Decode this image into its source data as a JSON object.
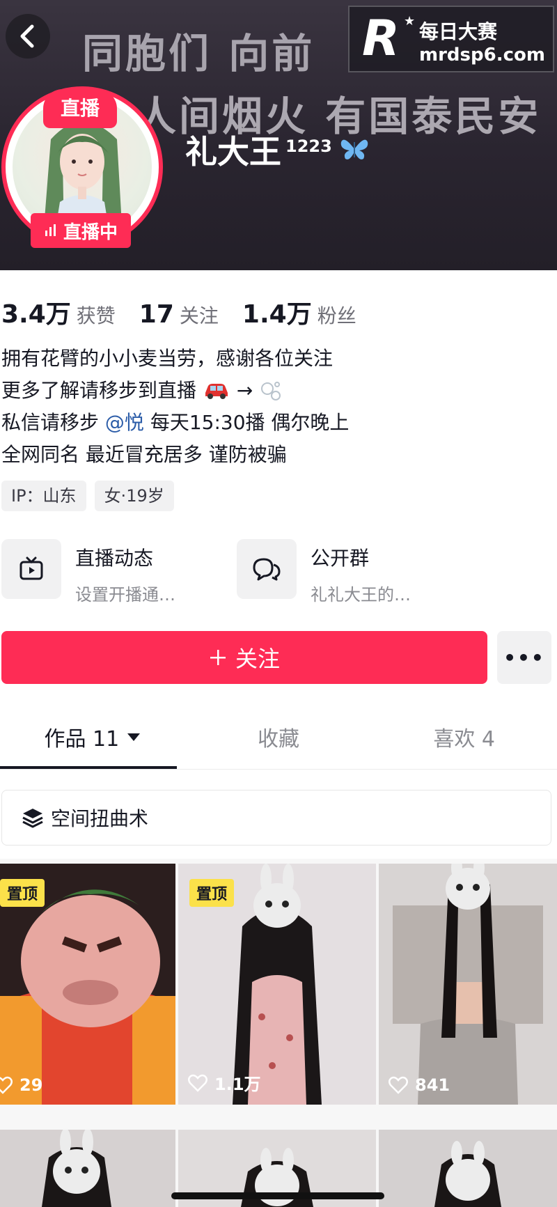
{
  "banner": {
    "line1": "同胞们 向前",
    "line2": "人间烟火 有国泰民安"
  },
  "watermark": {
    "logo": "R",
    "name": "每日大赛",
    "url": "mrdsp6.com"
  },
  "avatar": {
    "live_top": "直播",
    "live_bottom": "直播中"
  },
  "user": {
    "name": "礼大王",
    "suffix": "1223"
  },
  "stats": [
    {
      "value": "3.4万",
      "label": "获赞"
    },
    {
      "value": "17",
      "label": "关注"
    },
    {
      "value": "1.4万",
      "label": "粉丝"
    }
  ],
  "bio": {
    "line1": "拥有花臂的小小麦当劳，感谢各位关注",
    "line2": "更多了解请移步到直播",
    "line3_prefix": "私信请移步",
    "line3_mention": "@悦",
    "line3_suffix": "每天15:30播 偶尔晚上",
    "line4": "全网同名 最近冒充居多 谨防被骗"
  },
  "tags": [
    "IP：山东",
    "女·19岁"
  ],
  "shortcuts": [
    {
      "title": "直播动态",
      "subtitle": "设置开播通…",
      "icon": "tv-icon"
    },
    {
      "title": "公开群",
      "subtitle": "礼礼大王的…",
      "icon": "chat-bubbles-icon"
    }
  ],
  "follow_button": "关注",
  "more_button": "•••",
  "tabs": [
    {
      "label": "作品 11",
      "active": true
    },
    {
      "label": "收藏",
      "active": false
    },
    {
      "label": "喜欢 4",
      "active": false
    }
  ],
  "collection": "空间扭曲术",
  "videos": [
    {
      "pinned": true,
      "pin_label": "置顶",
      "likes": "29"
    },
    {
      "pinned": true,
      "pin_label": "置顶",
      "likes": "1.1万"
    },
    {
      "pinned": false,
      "pin_label": "",
      "likes": "841"
    }
  ],
  "colors": {
    "accent": "#fe2c55",
    "pin": "#fbe14a",
    "banner": "#2a2530"
  }
}
